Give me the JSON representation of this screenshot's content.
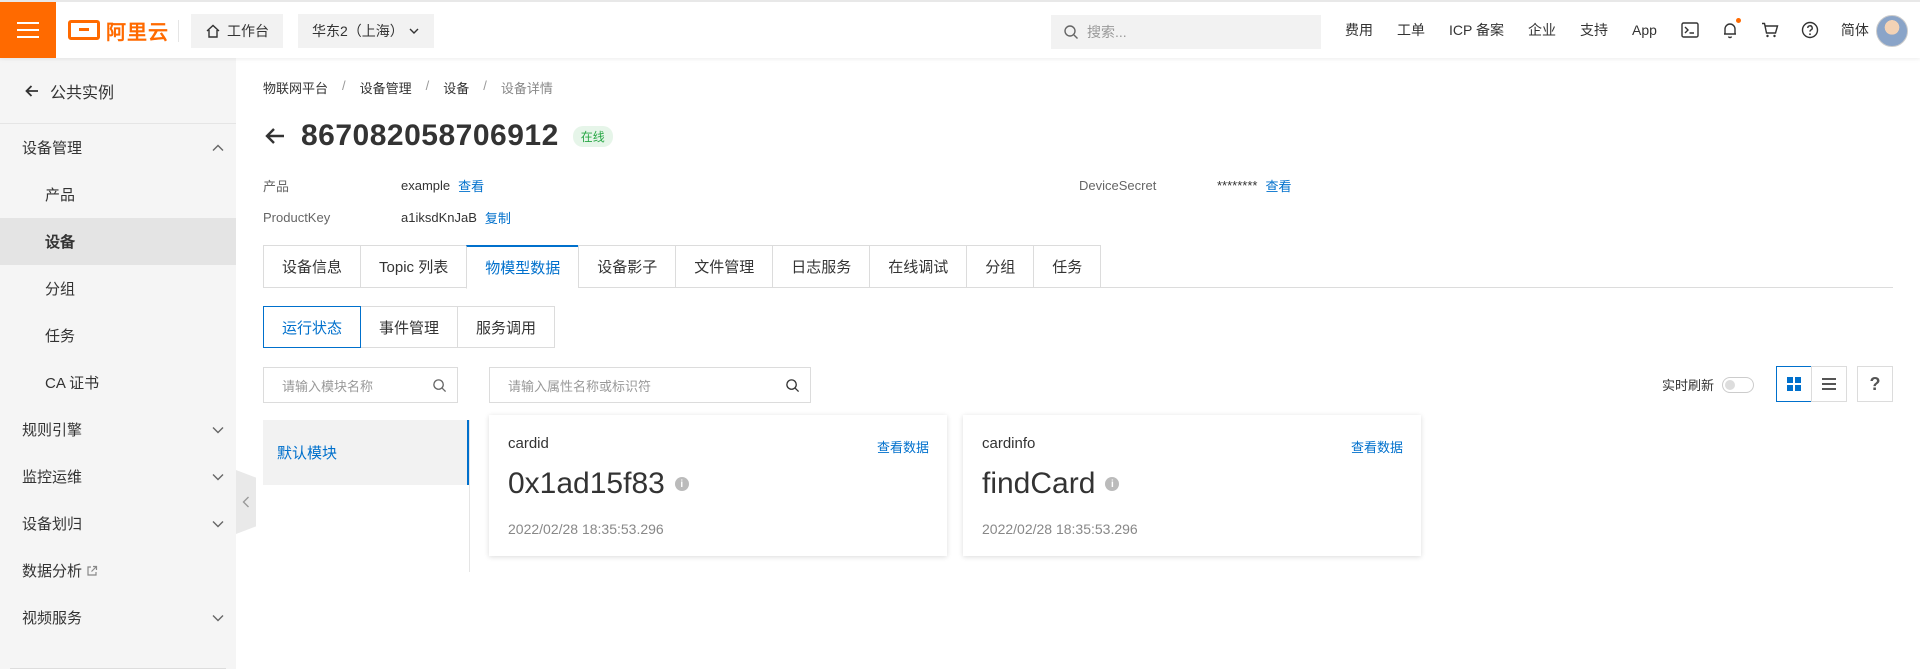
{
  "topbar": {
    "brand": "阿里云",
    "workbench": "工作台",
    "region": "华东2（上海）",
    "search_placeholder": "搜索...",
    "nav": [
      "费用",
      "工单",
      "ICP 备案",
      "企业",
      "支持",
      "App"
    ],
    "lang": "简体",
    "accent": "#ff6a00"
  },
  "sidebar": {
    "back": "公共实例",
    "groups": [
      {
        "label": "设备管理",
        "expanded": true
      },
      {
        "label": "规则引擎"
      },
      {
        "label": "监控运维"
      },
      {
        "label": "设备划归"
      },
      {
        "label": "数据分析"
      },
      {
        "label": "视频服务"
      }
    ],
    "subitems": [
      "产品",
      "设备",
      "分组",
      "任务",
      "CA 证书"
    ],
    "active_subitem": "设备"
  },
  "breadcrumb": [
    "物联网平台",
    "设备管理",
    "设备",
    "设备详情"
  ],
  "device": {
    "name": "867082058706912",
    "status": "在线",
    "product_label": "产品",
    "product_value": "example",
    "product_link": "查看",
    "productkey_label": "ProductKey",
    "productkey_value": "a1iksdKnJaB",
    "productkey_link": "复制",
    "secret_label": "DeviceSecret",
    "secret_value": "********",
    "secret_link": "查看"
  },
  "tabs": [
    "设备信息",
    "Topic 列表",
    "物模型数据",
    "设备影子",
    "文件管理",
    "日志服务",
    "在线调试",
    "分组",
    "任务"
  ],
  "active_tab": "物模型数据",
  "subtabs": [
    "运行状态",
    "事件管理",
    "服务调用"
  ],
  "active_subtab": "运行状态",
  "module_search_placeholder": "请输入模块名称",
  "property_search_placeholder": "请输入属性名称或标识符",
  "modules": [
    "默认模块"
  ],
  "realtime_label": "实时刷新",
  "help_label": "?",
  "cards": [
    {
      "name": "cardid",
      "link": "查看数据",
      "value": "0x1ad15f83",
      "time": "2022/02/28 18:35:53.296"
    },
    {
      "name": "cardinfo",
      "link": "查看数据",
      "value": "findCard",
      "time": "2022/02/28 18:35:53.296"
    }
  ],
  "colors": {
    "link": "#0070cc",
    "online": "#2aa847"
  }
}
